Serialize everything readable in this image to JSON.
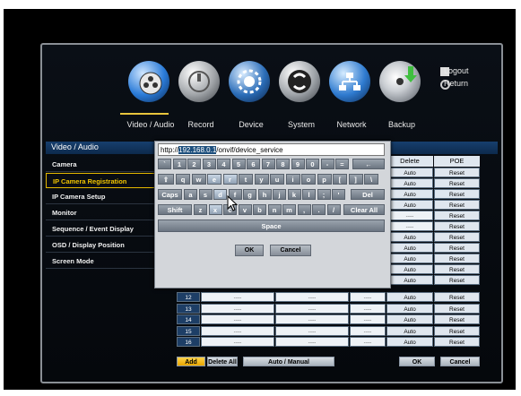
{
  "menu": {
    "items": [
      {
        "label": "Video / Audio",
        "icon": "video-audio-icon"
      },
      {
        "label": "Record",
        "icon": "record-icon"
      },
      {
        "label": "Device",
        "icon": "device-icon"
      },
      {
        "label": "System",
        "icon": "system-icon"
      },
      {
        "label": "Network",
        "icon": "network-icon"
      },
      {
        "label": "Backup",
        "icon": "backup-icon"
      }
    ],
    "logout": "Logout",
    "return": "Return"
  },
  "section_title": "Video / Audio",
  "sidebar": {
    "items": [
      {
        "label": "Camera"
      },
      {
        "label": "IP Camera Registration"
      },
      {
        "label": "IP Camera Setup"
      },
      {
        "label": "Monitor"
      },
      {
        "label": "Sequence / Event Display"
      },
      {
        "label": "OSD / Display Position"
      },
      {
        "label": "Screen Mode"
      }
    ]
  },
  "table": {
    "headers": {
      "delete": "Delete",
      "poe": "POE"
    },
    "top_rows": [
      {
        "delete": "Auto",
        "poe": "Reset"
      },
      {
        "delete": "Auto",
        "poe": "Reset"
      },
      {
        "delete": "Auto",
        "poe": "Reset"
      },
      {
        "delete": "Auto",
        "poe": "Reset"
      },
      {
        "delete": "----",
        "poe": "Reset"
      },
      {
        "delete": "----",
        "poe": "Reset"
      },
      {
        "delete": "Auto",
        "poe": "Reset"
      },
      {
        "delete": "Auto",
        "poe": "Reset"
      },
      {
        "delete": "Auto",
        "poe": "Reset"
      },
      {
        "delete": "Auto",
        "poe": "Reset"
      },
      {
        "delete": "Auto",
        "poe": "Reset"
      }
    ],
    "rows": [
      {
        "num": "12",
        "c1": "----",
        "c2": "----",
        "c3": "----",
        "delete": "Auto",
        "poe": "Reset"
      },
      {
        "num": "13",
        "c1": "----",
        "c2": "----",
        "c3": "----",
        "delete": "Auto",
        "poe": "Reset"
      },
      {
        "num": "14",
        "c1": "----",
        "c2": "----",
        "c3": "----",
        "delete": "Auto",
        "poe": "Reset"
      },
      {
        "num": "15",
        "c1": "----",
        "c2": "----",
        "c3": "----",
        "delete": "Auto",
        "poe": "Reset"
      },
      {
        "num": "16",
        "c1": "----",
        "c2": "----",
        "c3": "----",
        "delete": "Auto",
        "poe": "Reset"
      }
    ]
  },
  "bottom": {
    "add": "Add",
    "delete_all": "Delete All",
    "auto_manual": "Auto / Manual",
    "ok": "OK",
    "cancel": "Cancel"
  },
  "keyboard": {
    "url_prefix": "http://",
    "url_selected": "192.168.0.1",
    "url_suffix": "/onvif/device_service",
    "row1": [
      "`",
      "1",
      "2",
      "3",
      "4",
      "5",
      "6",
      "7",
      "8",
      "9",
      "0",
      "-",
      "="
    ],
    "backspace": "←",
    "row2": [
      "q",
      "w",
      "e",
      "r",
      "t",
      "y",
      "u",
      "i",
      "o",
      "p",
      "[",
      "]",
      "\\"
    ],
    "row3": [
      "a",
      "s",
      "d",
      "f",
      "g",
      "h",
      "j",
      "k",
      "l",
      ";",
      "'"
    ],
    "row4": [
      "z",
      "x",
      "c",
      "v",
      "b",
      "n",
      "m",
      ",",
      ".",
      "/"
    ],
    "caps": "Caps",
    "del": "Del",
    "shift": "Shift",
    "clear_all": "Clear All",
    "space": "Space",
    "ok": "OK",
    "cancel": "Cancel"
  },
  "colors": {
    "accent": "#f2c400",
    "header": "#173f6e"
  }
}
